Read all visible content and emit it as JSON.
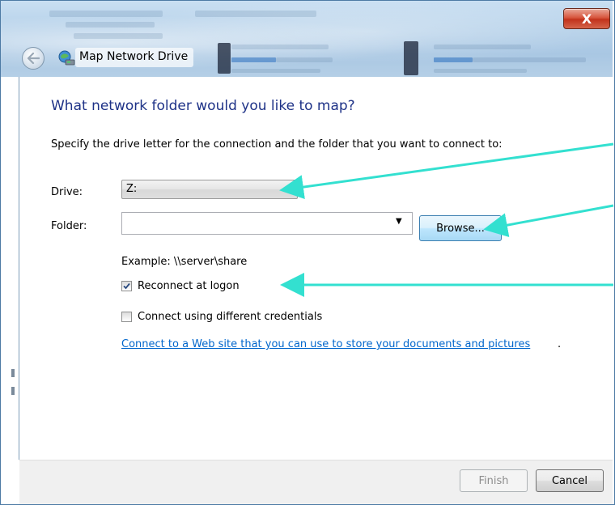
{
  "window": {
    "title": "Map Network Drive",
    "close_glyph": "X"
  },
  "content": {
    "heading": "What network folder would you like to map?",
    "description": "Specify the drive letter for the connection and the folder that you want to connect to:",
    "drive_label": "Drive:",
    "drive_value": "Z:",
    "folder_label": "Folder:",
    "folder_value": "",
    "browse_label": "Browse...",
    "example": "Example: \\\\server\\share",
    "reconnect_label": "Reconnect at logon",
    "reconnect_checked": true,
    "credentials_label": "Connect using different credentials",
    "credentials_checked": false,
    "link_text": "Connect to a Web site that you can use to store your documents and pictures",
    "link_suffix": "."
  },
  "footer": {
    "finish_label": "Finish",
    "cancel_label": "Cancel"
  },
  "icons": {
    "back": "back-arrow-icon",
    "title": "network-drive-icon",
    "dropdown": "chevron-down-icon",
    "checkmark": "checkmark-icon"
  },
  "colors": {
    "heading": "#1e3287",
    "link": "#0066cc",
    "annotation_arrow": "#33e0d0",
    "close_button": "#c7402a"
  }
}
